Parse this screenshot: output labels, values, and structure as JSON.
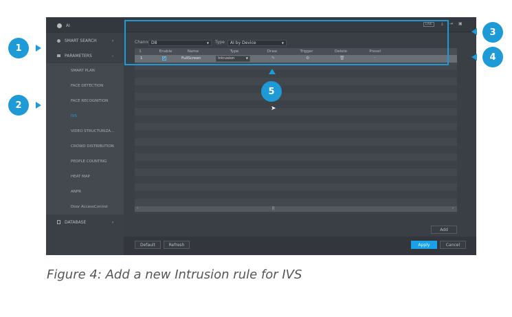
{
  "sidebar": {
    "title": "AI",
    "items": [
      {
        "label": "SMART SEARCH",
        "arrow": "›"
      },
      {
        "label": "PARAMETERS",
        "arrow": "-"
      }
    ],
    "subitems": [
      "SMART PLAN",
      "FACE DETECTION",
      "FACE RECOGNITION",
      "IVS",
      "VIDEO STRUCTURIZA...",
      "CROWD DISTRIBUTION",
      "PEOPLE COUNTING",
      "HEAT MAP",
      "ANPR",
      "Door AccessControl"
    ],
    "active": "IVS",
    "database": "DATABASE",
    "db_arrow": "›"
  },
  "topbar": {
    "live": "LIVE"
  },
  "filters": {
    "channel_label": "Channel",
    "channel_value": "D8",
    "type_label": "Type",
    "type_value": "AI by Device"
  },
  "table": {
    "headers": [
      "1",
      "Enable",
      "Name",
      "Type",
      "Draw",
      "Trigger",
      "Delete",
      "Preset"
    ],
    "rows": [
      {
        "index": "1",
        "enabled": true,
        "name": "FullScreen",
        "type": "Intrusion",
        "preset": "-"
      }
    ]
  },
  "buttons": {
    "add": "Add",
    "default": "Default",
    "refresh": "Refresh",
    "apply": "Apply",
    "cancel": "Cancel"
  },
  "callouts": [
    "1",
    "2",
    "3",
    "4",
    "5"
  ],
  "caption": "Figure 4: Add a new Intrusion rule for IVS",
  "colors": {
    "accent": "#1e9ad6",
    "apply": "#1aa0e8"
  }
}
